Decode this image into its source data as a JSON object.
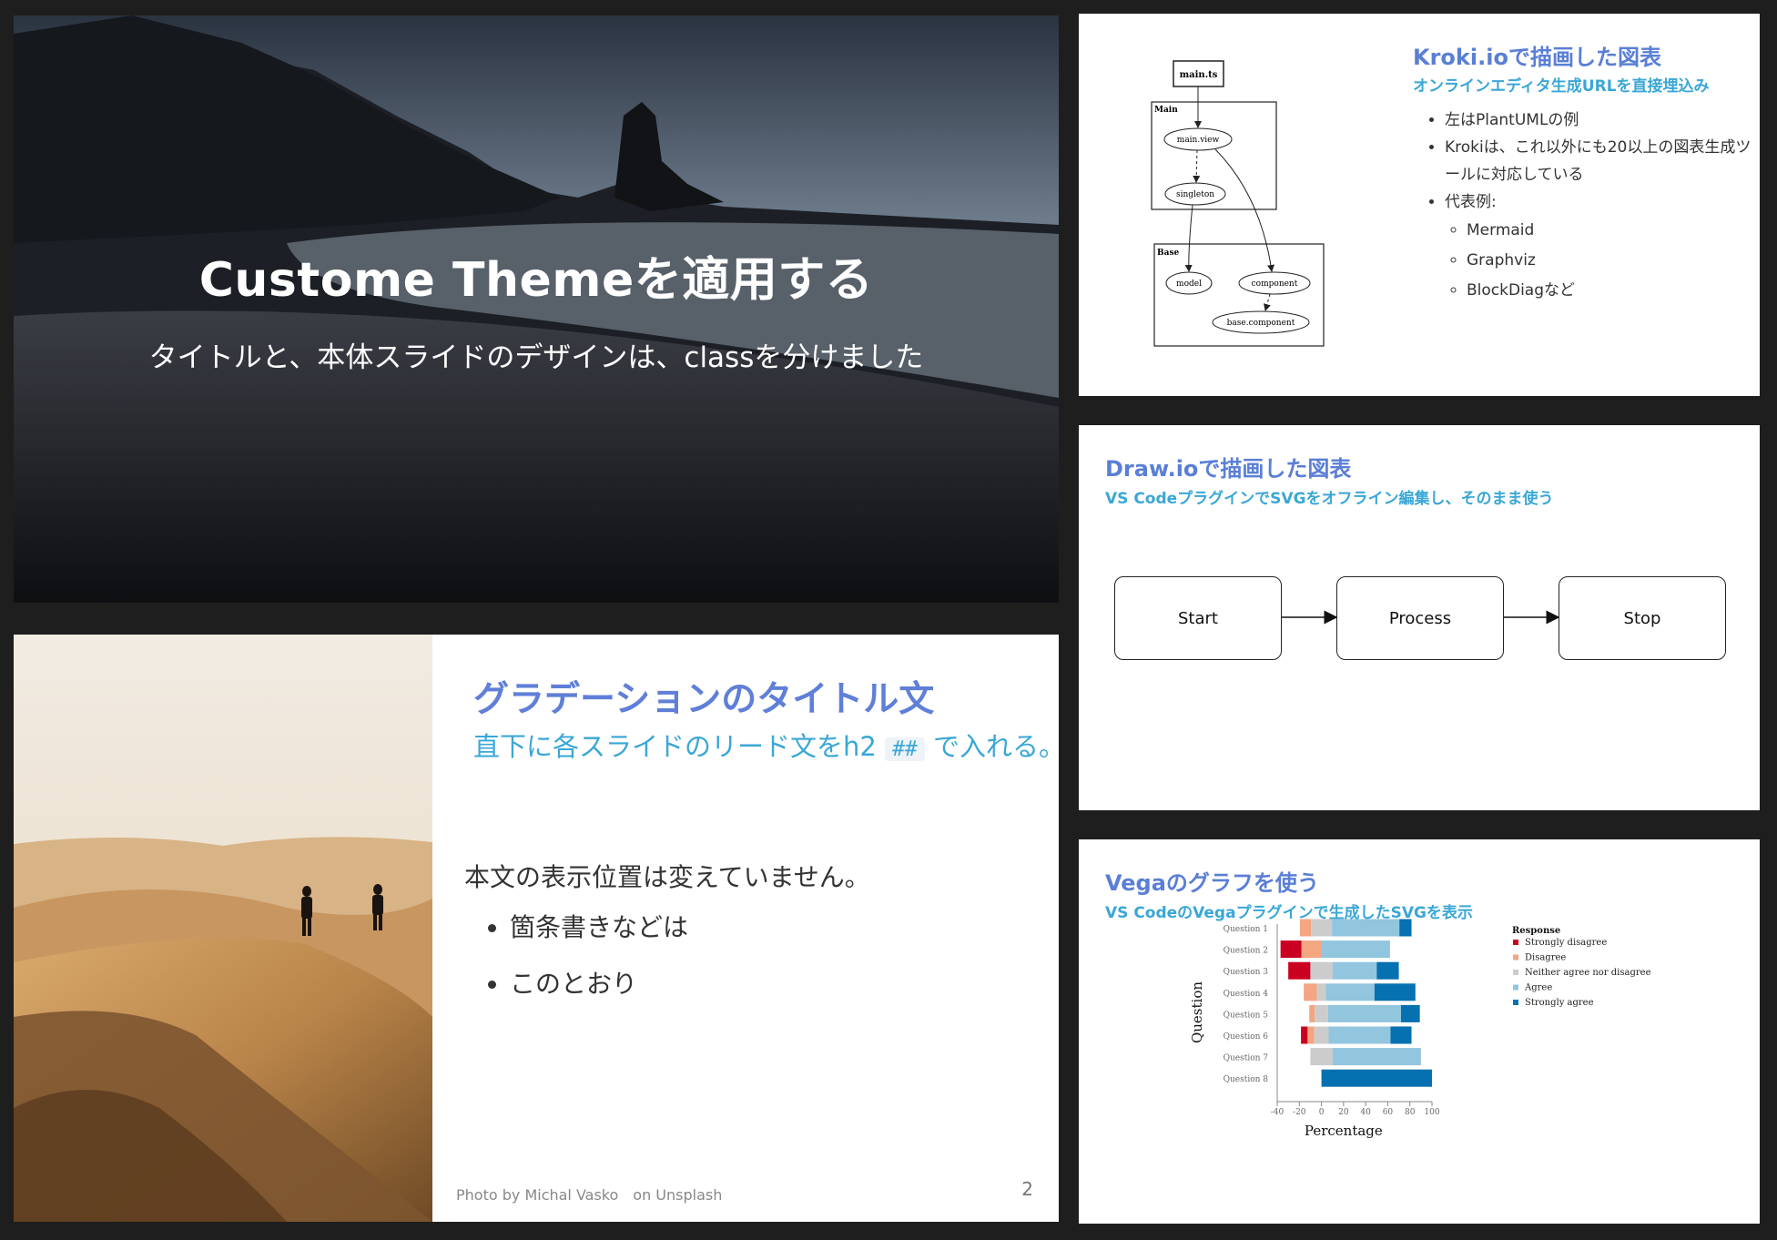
{
  "slide1": {
    "title": "Custome Themeを適用する",
    "subtitle": "タイトルと、本体スライドのデザインは、classを分けました"
  },
  "slide2": {
    "h1": "グラデーションのタイトル文",
    "h2_before": "直下に各スライドのリード文をh2",
    "h2_code": "##",
    "h2_after": "で入れる。",
    "body": "本文の表示位置は変えていません。",
    "bullets": [
      "箇条書きなどは",
      "このとおり"
    ],
    "credit": "Photo by Michal Vasko　on Unsplash",
    "page": "2"
  },
  "kroki": {
    "title": "Kroki.ioで描画した図表",
    "subtitle": "オンラインエディタ生成URLを直接埋込み",
    "bullets": [
      "左はPlantUMLの例",
      "Krokiは、これ以外にも20以上の図表生成ツールに対応している",
      "代表例:"
    ],
    "sub_bullets": [
      "Mermaid",
      "Graphviz",
      "BlockDiagなど"
    ],
    "diagram": {
      "root": "main.ts",
      "pkg_main": "Main",
      "pkg_base": "Base",
      "nodes": [
        "main.view",
        "singleton",
        "model",
        "component",
        "base.component"
      ]
    }
  },
  "drawio": {
    "title": "Draw.ioで描画した図表",
    "subtitle": "VS CodeプラグインでSVGをオフライン編集し、そのまま使う",
    "boxes": [
      "Start",
      "Process",
      "Stop"
    ]
  },
  "vega": {
    "title": "Vegaのグラフを使う",
    "subtitle": "VS CodeのVegaプラグインで生成したSVGを表示"
  },
  "chart_data": {
    "type": "bar",
    "stacked": "diverging",
    "categories": [
      "Question 1",
      "Question 2",
      "Question 3",
      "Question 4",
      "Question 5",
      "Question 6",
      "Question 7",
      "Question 8"
    ],
    "xlabel": "Percentage",
    "ylabel": "Question",
    "xlim": [
      -40,
      100
    ],
    "xticks": [
      "-40",
      "-20",
      "0",
      "20",
      "40",
      "60",
      "80",
      "100"
    ],
    "legend_title": "Response",
    "legend_position": "right",
    "series": [
      {
        "name": "Strongly disagree",
        "color": "#ca0020",
        "values": [
          0,
          19,
          20,
          0,
          0,
          6,
          0,
          0
        ]
      },
      {
        "name": "Disagree",
        "color": "#f4a582",
        "values": [
          10,
          18,
          0,
          12,
          5,
          6,
          0,
          0
        ]
      },
      {
        "name": "Neither agree nor disagree",
        "color": "#cccccc",
        "values": [
          19,
          0,
          20,
          8,
          12,
          13,
          20,
          0
        ]
      },
      {
        "name": "Agree",
        "color": "#92c5de",
        "values": [
          61,
          62,
          40,
          44,
          66,
          56,
          80,
          0
        ]
      },
      {
        "name": "Strongly agree",
        "color": "#0571b0",
        "values": [
          11,
          0,
          20,
          37,
          17,
          19,
          0,
          100
        ]
      }
    ]
  }
}
